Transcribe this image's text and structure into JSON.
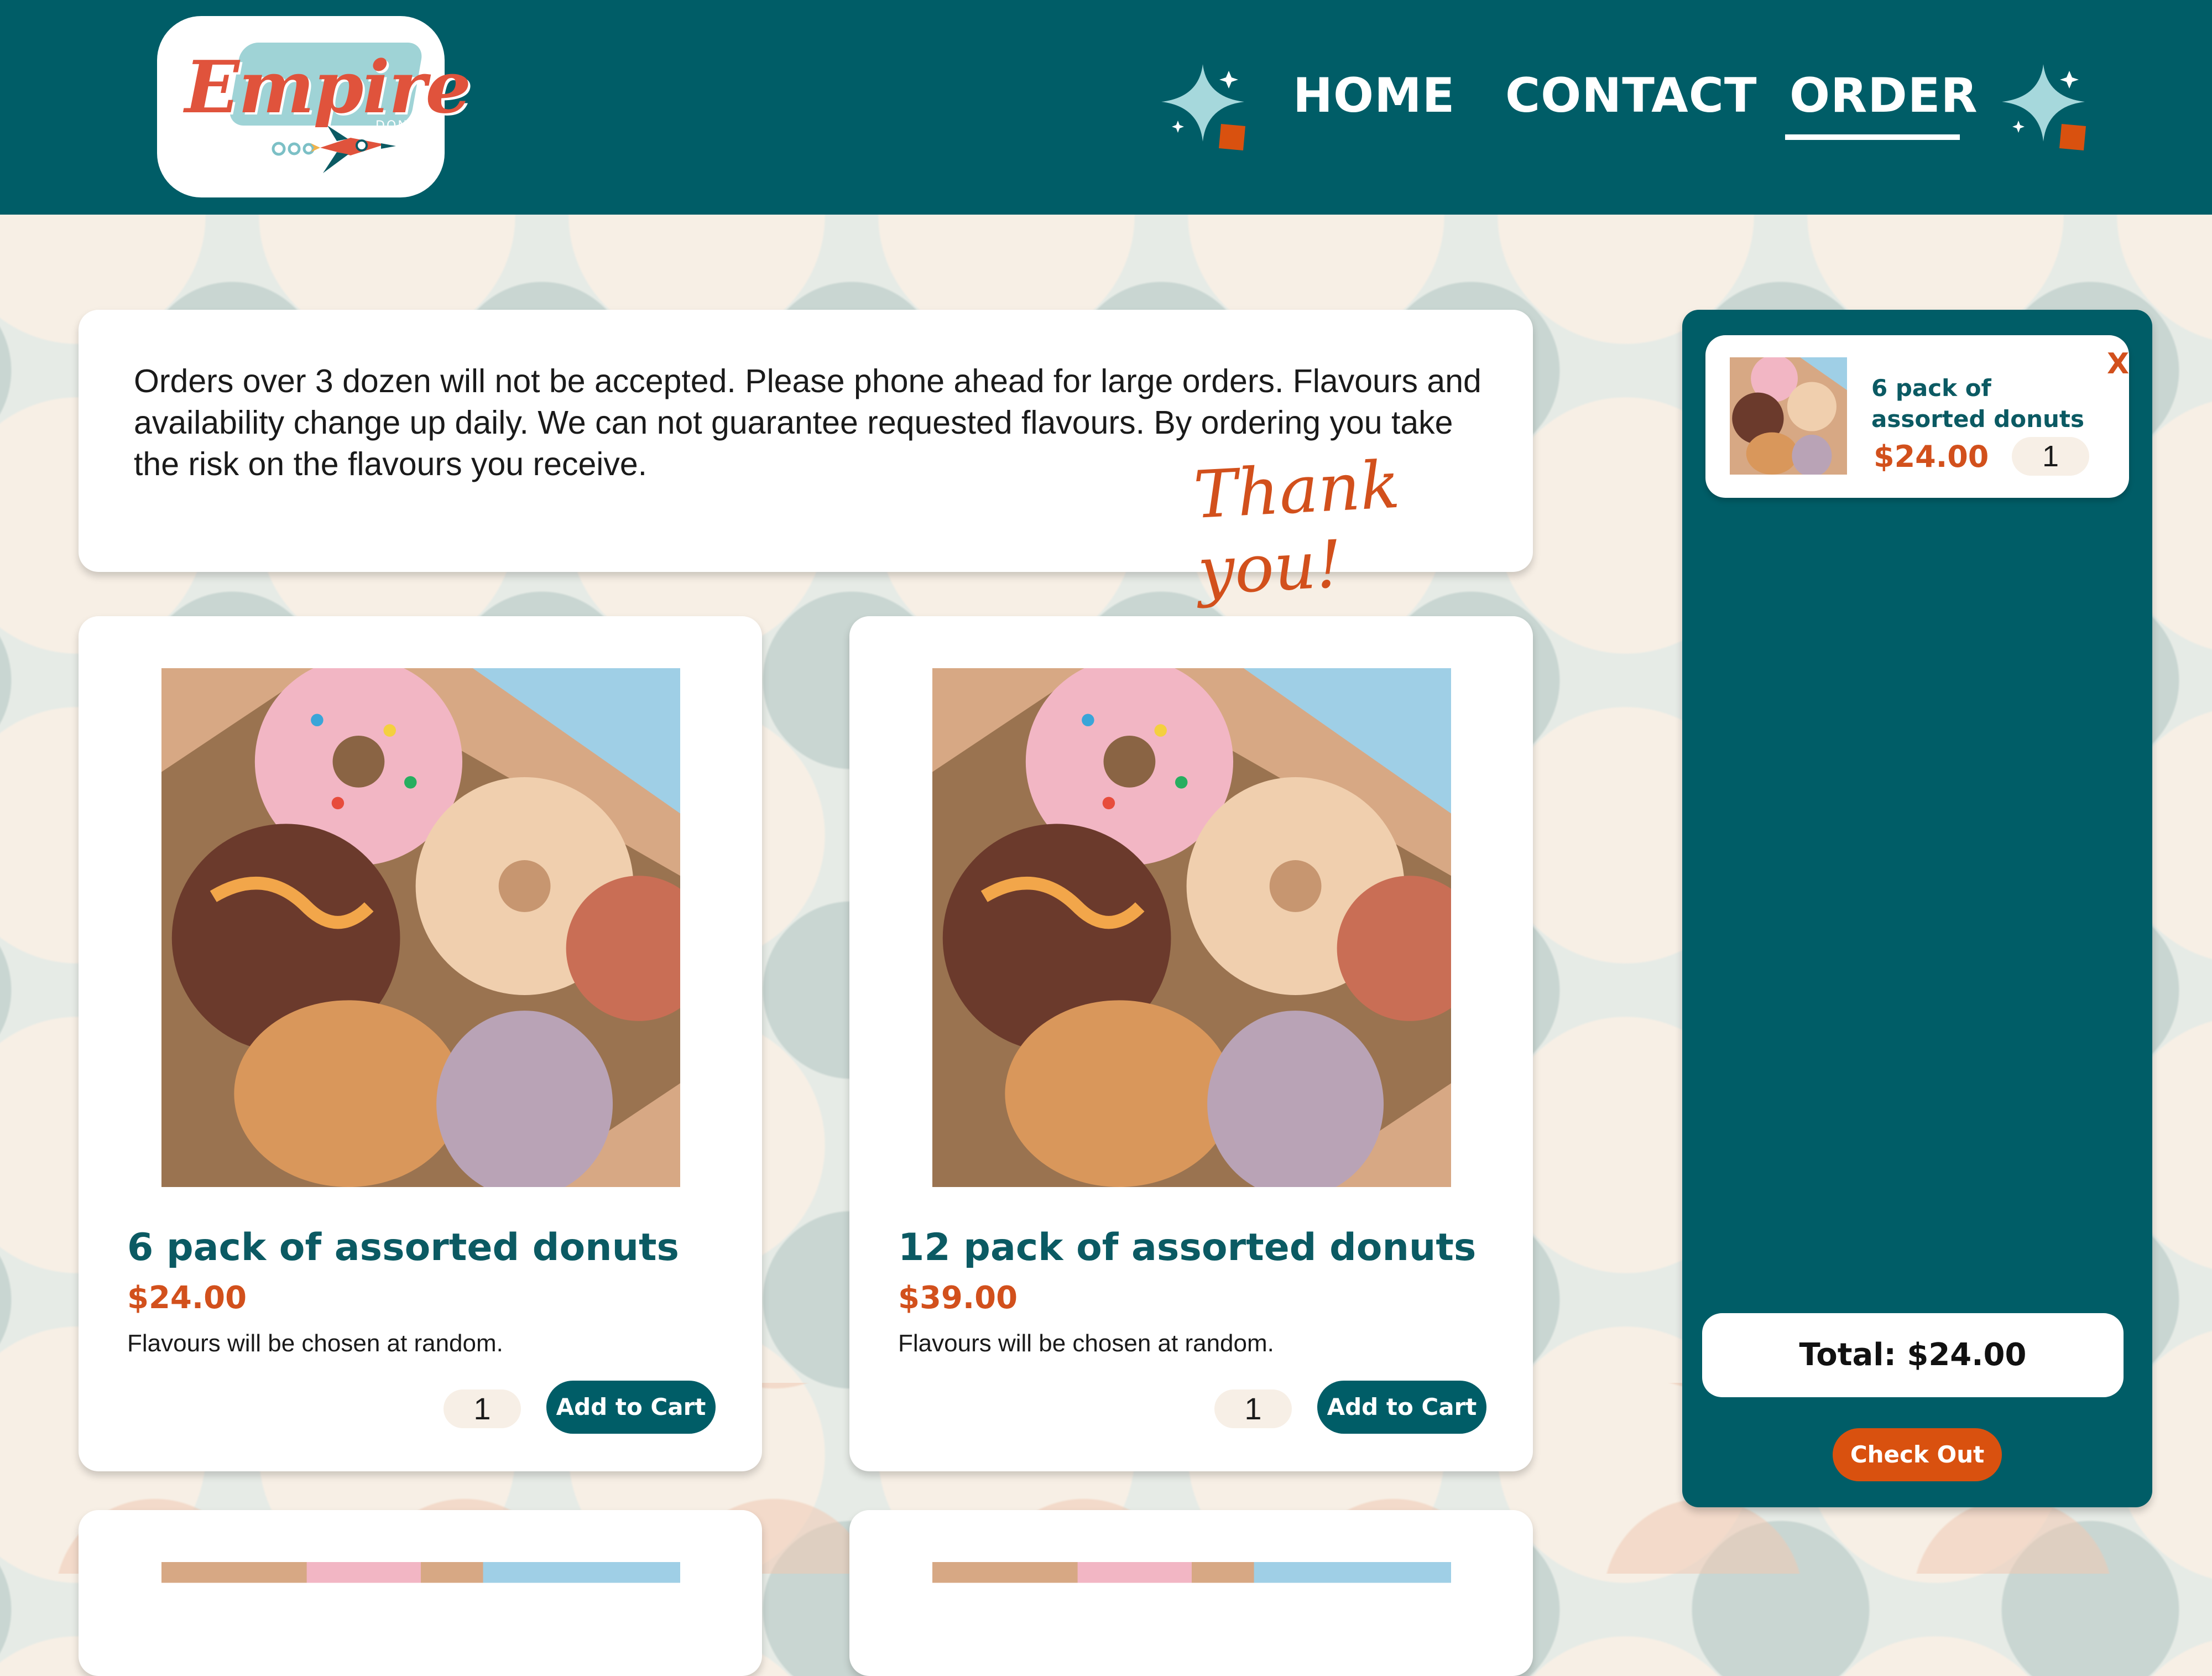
{
  "header": {
    "logo": {
      "wordmark": "Empire",
      "sub": "DONUTS"
    },
    "nav": {
      "home": "HOME",
      "contact": "CONTACT",
      "order": "ORDER",
      "active": "ORDER"
    }
  },
  "notice": {
    "text": "Orders over 3 dozen will not be accepted. Please phone ahead for large  orders. Flavours and availability change up daily. We can not guarantee  requested flavours. By ordering you take the risk on the flavours you  receive.",
    "signoff": "Thank you!"
  },
  "products": [
    {
      "title": "6 pack of assorted donuts",
      "price": "$24.00",
      "description": "Flavours will be chosen at random.",
      "quantity": "1",
      "button": "Add to Cart"
    },
    {
      "title": "12 pack of assorted donuts",
      "price": "$39.00",
      "description": "Flavours will be chosen at random.",
      "quantity": "1",
      "button": "Add to Cart"
    }
  ],
  "cart": {
    "items": [
      {
        "name": "6 pack of assorted donuts",
        "price": "$24.00",
        "quantity": "1",
        "remove": "X"
      }
    ],
    "total": "Total: $24.00",
    "checkout": "Check Out"
  },
  "colors": {
    "brand_teal": "#005d67",
    "accent_orange": "#d2501c",
    "title_teal": "#0b5a63",
    "background_cream": "#f7efe5"
  },
  "icons": [
    "sparkle-icon",
    "rocket-icon",
    "donut-photo"
  ]
}
